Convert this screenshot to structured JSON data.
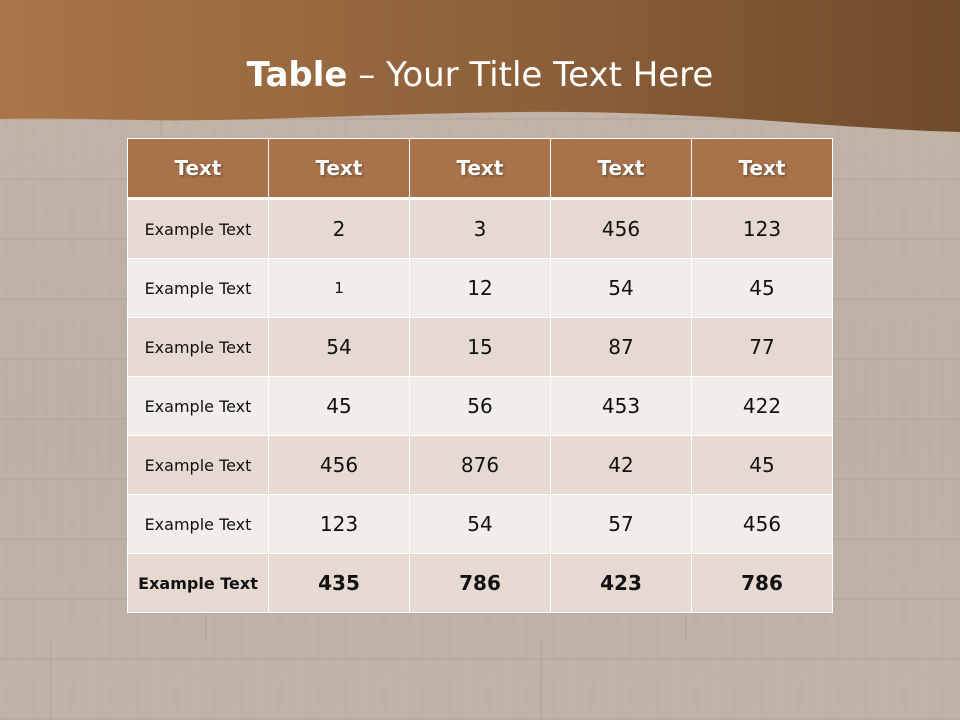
{
  "slide": {
    "title_bold": "Table",
    "title_rest": " – Your Title Text Here"
  },
  "colors": {
    "banner": "#9a6b45",
    "header_cell": "#a9724a",
    "row_odd": "#e5d9d1",
    "row_even": "#f1ede9"
  },
  "table": {
    "headers": [
      "Text",
      "Text",
      "Text",
      "Text",
      "Text"
    ],
    "rows": [
      [
        "Example Text",
        "2",
        "3",
        "456",
        "123"
      ],
      [
        "Example Text",
        "1",
        "12",
        "54",
        "45"
      ],
      [
        "Example Text",
        "54",
        "15",
        "87",
        "77"
      ],
      [
        "Example Text",
        "45",
        "56",
        "453",
        "422"
      ],
      [
        "Example Text",
        "456",
        "876",
        "42",
        "45"
      ],
      [
        "Example Text",
        "123",
        "54",
        "57",
        "456"
      ],
      [
        "Example Text",
        "435",
        "786",
        "423",
        "786"
      ]
    ]
  }
}
